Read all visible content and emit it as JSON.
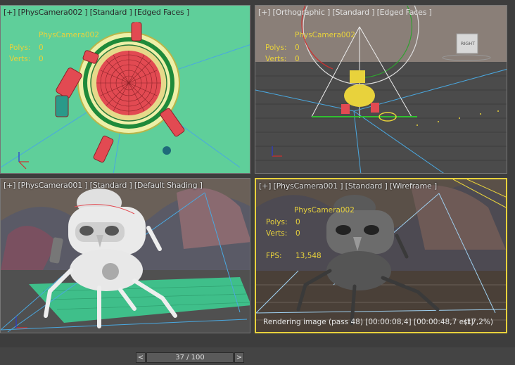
{
  "viewports": {
    "top_left": {
      "label": "[+] [PhysCamera002 ] [Standard ] [Edged Faces ]",
      "camera": "PhysCamera002",
      "polys_label": "Polys:",
      "polys_value": "0",
      "verts_label": "Verts:",
      "verts_value": "0"
    },
    "top_right": {
      "label": "[+] [Orthographic ] [Standard ] [Edged Faces ]",
      "camera": "PhysCamera002",
      "polys_label": "Polys:",
      "polys_value": "0",
      "verts_label": "Verts:",
      "verts_value": "0",
      "viewcube_face": "RIGHT"
    },
    "bottom_left": {
      "label": "[+] [PhysCamera001 ] [Standard ] [Default Shading ]"
    },
    "bottom_right": {
      "label": "[+] [PhysCamera001 ] [Standard ] [Wireframe ]",
      "camera": "PhysCamera002",
      "polys_label": "Polys:",
      "polys_value": "0",
      "verts_label": "Verts:",
      "verts_value": "0",
      "fps_label": "FPS:",
      "fps_value": "13,548",
      "render_status": "Rendering image (pass 48) [00:00:08,4] [00:00:48,7 est]",
      "render_percent": "(17,2%)"
    }
  },
  "timeline": {
    "prev": "<",
    "frame": "37 / 100",
    "next": ">"
  },
  "colors": {
    "active_border": "#e8d23c",
    "info_text": "#e8d23c",
    "top_left_bg": "#5fcf9a"
  }
}
